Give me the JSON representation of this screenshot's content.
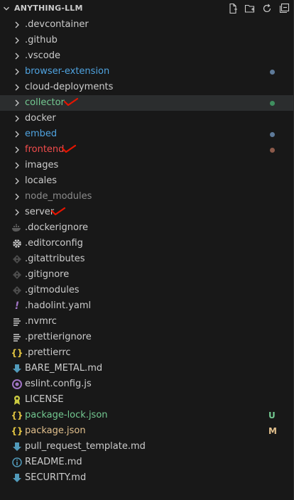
{
  "explorer": {
    "title": "ANYTHING-LLM",
    "actions": [
      {
        "name": "new-file-icon"
      },
      {
        "name": "new-folder-icon"
      },
      {
        "name": "refresh-icon"
      },
      {
        "name": "collapse-all-icon"
      }
    ]
  },
  "colors": {
    "default": "#cccccc",
    "blue": "#4fa3e0",
    "green": "#73c991",
    "red": "#f14c4c",
    "dim": "#8c8c8c",
    "dot_blue": "#5e7a99",
    "dot_green": "#3f8f5f",
    "dot_red": "#8c5a4a",
    "check": "#e51400"
  },
  "folders": [
    {
      "label": ".devcontainer"
    },
    {
      "label": ".github"
    },
    {
      "label": ".vscode"
    },
    {
      "label": "browser-extension"
    },
    {
      "label": "cloud-deployments"
    },
    {
      "label": "collector"
    },
    {
      "label": "docker"
    },
    {
      "label": "embed"
    },
    {
      "label": "frontend"
    },
    {
      "label": "images"
    },
    {
      "label": "locales"
    },
    {
      "label": "node_modules"
    },
    {
      "label": "server"
    }
  ],
  "files": [
    {
      "label": ".dockerignore"
    },
    {
      "label": ".editorconfig"
    },
    {
      "label": ".gitattributes"
    },
    {
      "label": ".gitignore"
    },
    {
      "label": ".gitmodules"
    },
    {
      "label": ".hadolint.yaml"
    },
    {
      "label": ".nvmrc"
    },
    {
      "label": ".prettierignore"
    },
    {
      "label": ".prettierrc"
    },
    {
      "label": "BARE_METAL.md"
    },
    {
      "label": "eslint.config.js"
    },
    {
      "label": "LICENSE"
    },
    {
      "label": "package-lock.json",
      "badge": "U"
    },
    {
      "label": "package.json",
      "badge": "M"
    },
    {
      "label": "pull_request_template.md"
    },
    {
      "label": "README.md"
    },
    {
      "label": "SECURITY.md"
    }
  ]
}
